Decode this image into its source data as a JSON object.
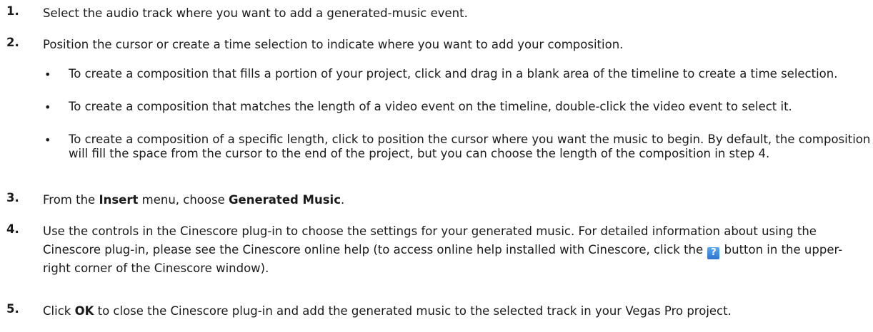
{
  "steps": [
    {
      "num": "1.",
      "text": "Select the audio track where you want to add a generated-music event."
    },
    {
      "num": "2.",
      "text": "Position the cursor or create a time selection to indicate where you want to add your composition."
    },
    {
      "num": "3.",
      "pre": "From the ",
      "menu": "Insert",
      "mid": " menu, choose ",
      "command": "Generated Music",
      "post": "."
    },
    {
      "num": "4.",
      "pre": "Use the controls in the Cinescore plug-in to choose the settings for your generated music. For detailed information about using the Cinescore plug-in, please see the Cinescore online help (to access online help installed with Cinescore, click the ",
      "post": " button in the upper-right corner of the Cinescore window)."
    },
    {
      "num": "5.",
      "pre": "Click ",
      "button": "OK",
      "post": " to close the Cinescore plug-in and add the generated music to the selected track in your Vegas Pro project."
    }
  ],
  "bullets": [
    "To create a composition that fills a portion of your project, click and drag in a blank area of the timeline to create a time selection.",
    "To create a composition that matches the length of a video event on the timeline, double-click the video event to select it.",
    "To create a composition of a specific length, click to position the cursor where you want the music to begin. By default, the composition will fill the space from the cursor to the end of the project, but you can choose the length of the composition in step 4."
  ],
  "bullet_glyph": "•",
  "help_button": {
    "label": "?",
    "icon": "help-question-icon",
    "color": "#2a74cf"
  }
}
